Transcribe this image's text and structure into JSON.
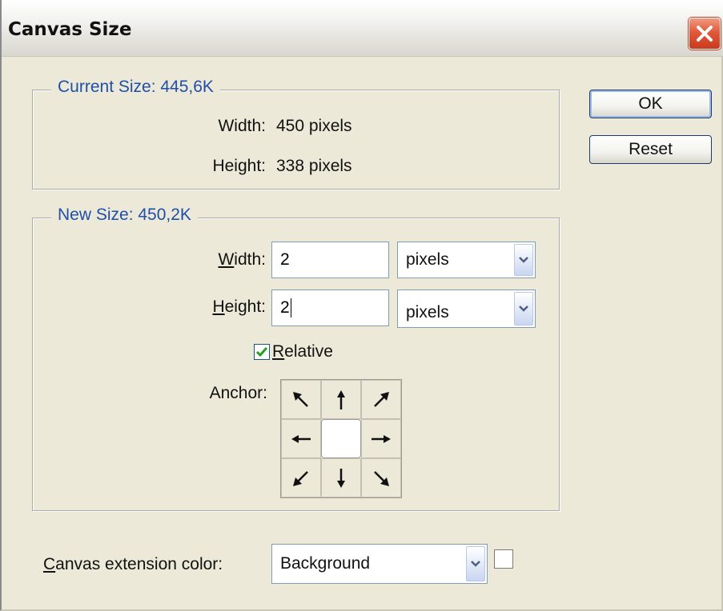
{
  "window": {
    "title": "Canvas Size"
  },
  "buttons": {
    "ok": "OK",
    "reset": "Reset"
  },
  "current_size": {
    "legend": "Current Size: 445,6K",
    "width_label": "Width:",
    "width_value": "450 pixels",
    "height_label": "Height:",
    "height_value": "338 pixels"
  },
  "new_size": {
    "legend": "New Size: 450,2K",
    "width_label_mnemonic": "W",
    "width_label_rest": "idth:",
    "width_value": "2",
    "width_unit": "pixels",
    "height_label_mnemonic": "H",
    "height_label_rest": "eight:",
    "height_value": "2",
    "height_unit": "pixels",
    "relative_mnemonic": "R",
    "relative_rest": "elative",
    "relative_checked": true,
    "anchor_label": "Anchor:",
    "anchor_selected": "center"
  },
  "extension": {
    "label_mnemonic": "C",
    "label_rest": "anvas extension color:",
    "value": "Background",
    "swatch_color": "#ffffff"
  },
  "icons": {
    "close": "close-icon",
    "dropdown": "chevron-down-icon",
    "check": "checkmark-icon",
    "anchor_arrows": [
      "arrow-up-left-icon",
      "arrow-up-icon",
      "arrow-up-right-icon",
      "arrow-left-icon",
      "anchor-center",
      "arrow-right-icon",
      "arrow-down-left-icon",
      "arrow-down-icon",
      "arrow-down-right-icon"
    ]
  },
  "colors": {
    "legend": "#1f4fa8",
    "dialog_bg": "#ece9d8",
    "close_button": "#e2593a"
  }
}
